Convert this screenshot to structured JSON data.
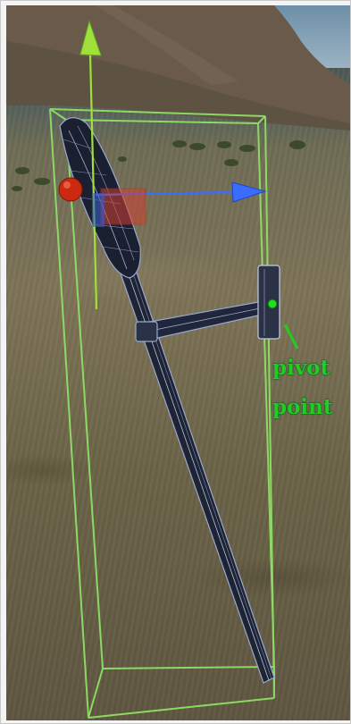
{
  "annotation": {
    "line1": "pivot",
    "line2": "point",
    "color": "#22cc22"
  },
  "gizmo": {
    "y_axis_color": "#9fe03a",
    "x_axis_color": "#3a6cff",
    "z_handle_color": "#cc2a10",
    "plane_handle_color": "#d04030",
    "bounds_color": "#8ee065",
    "pivot_dot_color": "#22dd22"
  },
  "object": {
    "wireframe_color": "#9aa8d0",
    "mesh_color": "#1e2433"
  },
  "icons": [
    "y-axis-arrow-icon",
    "x-axis-arrow-icon",
    "z-axis-sphere-icon",
    "xy-plane-handle-icon",
    "pivot-dot-icon"
  ]
}
